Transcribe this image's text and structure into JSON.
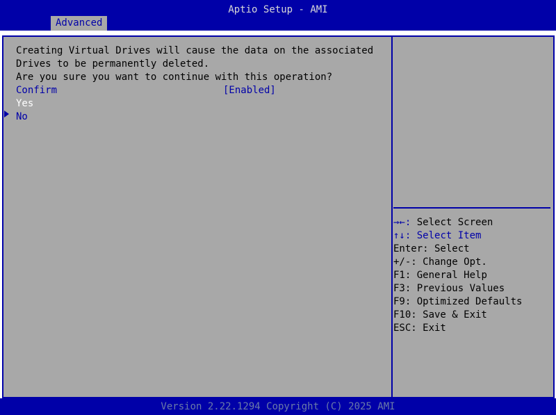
{
  "header": {
    "title": "Aptio Setup - AMI",
    "tab": "Advanced"
  },
  "main": {
    "message": [
      "Creating Virtual Drives will cause the data on the associated",
      "Drives to be permanently deleted.",
      "Are you sure you want to continue with this operation?"
    ],
    "confirm_label": "Confirm",
    "confirm_value": "[Enabled]",
    "options": [
      "Yes",
      "No"
    ]
  },
  "help": {
    "keys": [
      {
        "key": "→←:",
        "desc": " Select Screen"
      },
      {
        "key": "↑↓:",
        "desc": " Select Item"
      },
      {
        "key": "Enter:",
        "desc": " Select"
      },
      {
        "key": "+/-:",
        "desc": " Change Opt."
      },
      {
        "key": "F1:",
        "desc": " General Help"
      },
      {
        "key": "F3:",
        "desc": " Previous Values"
      },
      {
        "key": "F9:",
        "desc": " Optimized Defaults"
      },
      {
        "key": "F10:",
        "desc": " Save & Exit"
      },
      {
        "key": "ESC:",
        "desc": " Exit"
      }
    ]
  },
  "footer": {
    "version": "Version 2.22.1294 Copyright (C) 2025 AMI"
  },
  "colors": {
    "background": "#a8a8a8",
    "bar": "#0000a8",
    "highlight": "#ffffff"
  }
}
